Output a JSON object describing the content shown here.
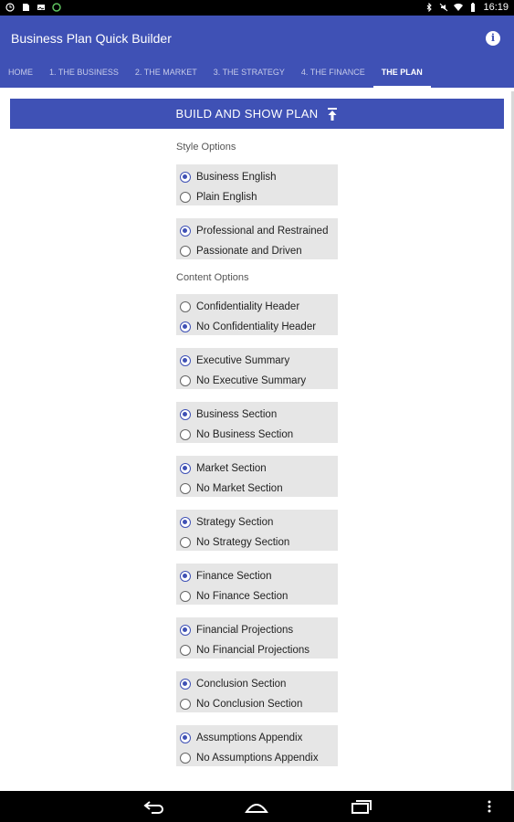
{
  "status_bar": {
    "time": "16:19",
    "left_icons": [
      "clock-icon",
      "sd-card-icon",
      "image-icon",
      "sync-icon"
    ],
    "right_icons": [
      "bluetooth-icon",
      "mute-icon",
      "wifi-icon",
      "battery-icon"
    ]
  },
  "app_bar": {
    "title": "Business Plan Quick Builder",
    "info_icon": "info-icon",
    "tabs": [
      {
        "label": "HOME"
      },
      {
        "label": "1. THE BUSINESS"
      },
      {
        "label": "2. THE MARKET"
      },
      {
        "label": "3. THE STRATEGY"
      },
      {
        "label": "4. THE FINANCE"
      },
      {
        "label": "THE PLAN",
        "active": true
      }
    ]
  },
  "build_button": {
    "label": "BUILD AND SHOW PLAN",
    "icon": "upload-icon"
  },
  "style_options": {
    "label": "Style Options",
    "groups": [
      {
        "options": [
          {
            "label": "Business English",
            "selected": true
          },
          {
            "label": "Plain English",
            "selected": false
          }
        ]
      },
      {
        "options": [
          {
            "label": "Professional and Restrained",
            "selected": true
          },
          {
            "label": "Passionate and Driven",
            "selected": false
          }
        ]
      }
    ]
  },
  "content_options": {
    "label": "Content Options",
    "groups": [
      {
        "options": [
          {
            "label": "Confidentiality Header",
            "selected": false
          },
          {
            "label": "No Confidentiality Header",
            "selected": true
          }
        ]
      },
      {
        "options": [
          {
            "label": "Executive Summary",
            "selected": true
          },
          {
            "label": "No Executive Summary",
            "selected": false
          }
        ]
      },
      {
        "options": [
          {
            "label": "Business Section",
            "selected": true
          },
          {
            "label": "No Business Section",
            "selected": false
          }
        ]
      },
      {
        "options": [
          {
            "label": "Market Section",
            "selected": true
          },
          {
            "label": "No Market Section",
            "selected": false
          }
        ]
      },
      {
        "options": [
          {
            "label": "Strategy Section",
            "selected": true
          },
          {
            "label": "No Strategy Section",
            "selected": false
          }
        ]
      },
      {
        "options": [
          {
            "label": "Finance Section",
            "selected": true
          },
          {
            "label": "No Finance Section",
            "selected": false
          }
        ]
      },
      {
        "options": [
          {
            "label": "Financial Projections",
            "selected": true
          },
          {
            "label": "No Financial Projections",
            "selected": false
          }
        ]
      },
      {
        "options": [
          {
            "label": "Conclusion Section",
            "selected": true
          },
          {
            "label": "No Conclusion Section",
            "selected": false
          }
        ]
      },
      {
        "options": [
          {
            "label": "Assumptions Appendix",
            "selected": true
          },
          {
            "label": "No Assumptions Appendix",
            "selected": false
          }
        ]
      }
    ]
  },
  "nav_bar": {
    "icons": [
      "back-icon",
      "home-icon",
      "recents-icon",
      "menu-icon"
    ]
  },
  "colors": {
    "primary": "#3f51b5",
    "group_bg": "#e6e6e6"
  }
}
